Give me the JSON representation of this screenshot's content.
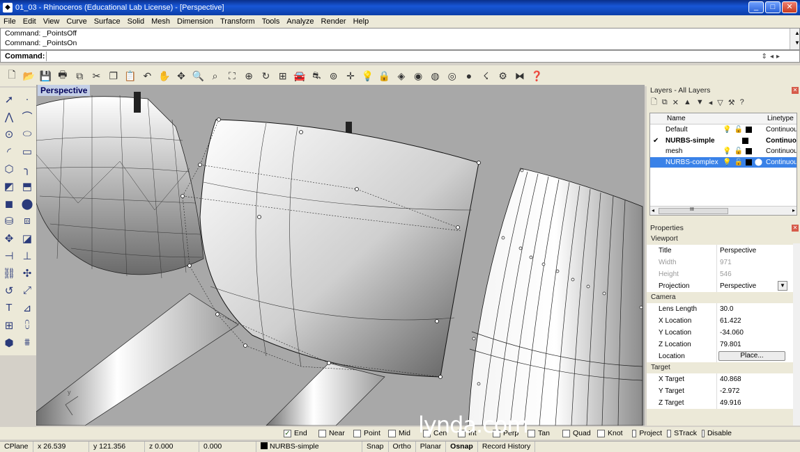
{
  "window": {
    "title": "01_03 - Rhinoceros (Educational Lab License) - [Perspective]"
  },
  "menu": [
    "File",
    "Edit",
    "View",
    "Curve",
    "Surface",
    "Solid",
    "Mesh",
    "Dimension",
    "Transform",
    "Tools",
    "Analyze",
    "Render",
    "Help"
  ],
  "command": {
    "history": [
      "Command: _PointsOff",
      "Command: _PointsOn"
    ],
    "prompt_label": "Command:",
    "value": ""
  },
  "viewport": {
    "label": "Perspective"
  },
  "layers": {
    "title": "Layers - All Layers",
    "columns": [
      "Name",
      "Linetype"
    ],
    "rows": [
      {
        "name": "Default",
        "linetype": "Continuous",
        "current": false,
        "selected": false
      },
      {
        "name": "NURBS-simple",
        "linetype": "Continuous",
        "current": true,
        "selected": false
      },
      {
        "name": "mesh",
        "linetype": "Continuous",
        "current": false,
        "selected": false
      },
      {
        "name": "NURBS-complex",
        "linetype": "Continuous",
        "current": false,
        "selected": true
      }
    ],
    "scroll_label": "III"
  },
  "properties": {
    "title": "Properties",
    "viewport_section": "Viewport",
    "title_label": "Title",
    "title_value": "Perspective",
    "width_label": "Width",
    "width_value": "971",
    "height_label": "Height",
    "height_value": "546",
    "projection_label": "Projection",
    "projection_value": "Perspective",
    "camera_section": "Camera",
    "lens_label": "Lens Length",
    "lens_value": "30.0",
    "xloc_label": "X Location",
    "xloc_value": "61.422",
    "yloc_label": "Y Location",
    "yloc_value": "-34.060",
    "zloc_label": "Z Location",
    "zloc_value": "79.801",
    "location_label": "Location",
    "place_button": "Place...",
    "target_section": "Target",
    "xtgt_label": "X Target",
    "xtgt_value": "40.868",
    "ytgt_label": "Y Target",
    "ytgt_value": "-2.972",
    "ztgt_label": "Z Target",
    "ztgt_value": "49.916"
  },
  "osnap": [
    {
      "label": "End",
      "checked": true
    },
    {
      "label": "Near",
      "checked": false
    },
    {
      "label": "Point",
      "checked": false
    },
    {
      "label": "Mid",
      "checked": false
    },
    {
      "label": "Cen",
      "checked": false
    },
    {
      "label": "Int",
      "checked": false
    },
    {
      "label": "Perp",
      "checked": false
    },
    {
      "label": "Tan",
      "checked": false
    },
    {
      "label": "Quad",
      "checked": false
    },
    {
      "label": "Knot",
      "checked": false
    },
    {
      "label": "Project",
      "checked": false
    },
    {
      "label": "STrack",
      "checked": false
    },
    {
      "label": "Disable",
      "checked": false
    }
  ],
  "status": {
    "cplane": "CPlane",
    "x": "x 26.539",
    "y": "y 121.356",
    "z": "z 0.000",
    "extra": "0.000",
    "layer": "NURBS-simple",
    "snap": "Snap",
    "ortho": "Ortho",
    "planar": "Planar",
    "osnap": "Osnap",
    "record": "Record History"
  },
  "watermark": "lynda.com"
}
